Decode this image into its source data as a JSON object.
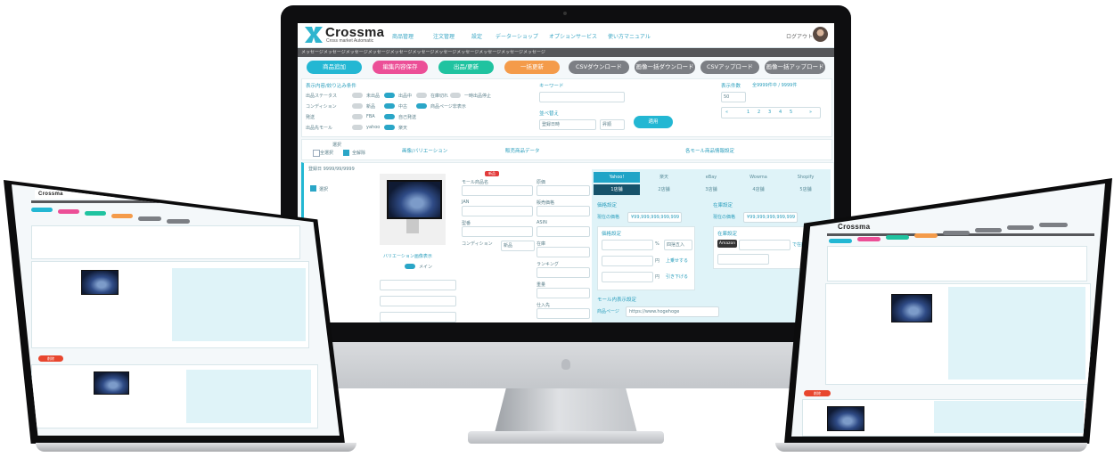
{
  "app": {
    "brand": "Crossma",
    "tagline": "Cross market Automatic",
    "nav": [
      "商品管理",
      "注文管理",
      "設定",
      "データーショップ",
      "オプションサービス",
      "使い方マニュアル"
    ],
    "logout": "ログアウト",
    "ticker": "メッセージメッセージメッセージメッセージメッセージメッセージメッセージメッセージメッセージメッセージメッセージ"
  },
  "actions": [
    {
      "label": "商品追加",
      "color": "#23b7d3"
    },
    {
      "label": "編集内容保存",
      "color": "#ec4f97"
    },
    {
      "label": "出品/更新",
      "color": "#1fc3a0"
    },
    {
      "label": "一括更新",
      "color": "#f49b4a"
    },
    {
      "label": "CSVダウンロード",
      "color": "#7c7f84"
    },
    {
      "label": "画像一括ダウンロード",
      "color": "#7c7f84"
    },
    {
      "label": "CSVアップロード",
      "color": "#7c7f84"
    },
    {
      "label": "画像一括アップロード",
      "color": "#7c7f84"
    }
  ],
  "filters": {
    "title": "表示内容/絞り込み条件",
    "rows": [
      {
        "label": "出品ステータス",
        "opts": [
          "未出品",
          "出品中",
          "在庫切れ",
          "一時出品停止"
        ]
      },
      {
        "label": "コンディション",
        "opts": [
          "新品",
          "中古",
          "商品ページ非表示"
        ]
      },
      {
        "label": "発送",
        "opts": [
          "FBA",
          "自己発送"
        ]
      },
      {
        "label": "出品先モール",
        "opts": [
          "yahoo",
          "楽天"
        ]
      }
    ],
    "keyword_label": "キーワード",
    "sort_label": "並べ替え",
    "sort_value": "登録日時",
    "sort_order": "昇順",
    "apply": "適用",
    "count_label": "表示件数",
    "count_value": "50",
    "count_summary": "全9999件中 / 9999件",
    "pages": [
      "«",
      "1",
      "2",
      "3",
      "4",
      "5",
      "»"
    ]
  },
  "columns": {
    "select": "選択",
    "select_all": "全選択",
    "deselect_all": "全解除",
    "variation": "画像/バリエーション",
    "data": "販売商品データ",
    "mall": "各モール商品情報設定"
  },
  "item": {
    "reg_date": "登録日 9999/99/9999",
    "variation_caption": "バリエーション画像表示",
    "main_label": "メイン",
    "fields_mid": [
      "モール商品名",
      "JAN",
      "型番",
      "コンディション"
    ],
    "condition_value": "新品",
    "fields_right": [
      "原価",
      "販売価格",
      "ASIN",
      "在庫",
      "ランキング",
      "重量",
      "仕入先"
    ],
    "badge": "新品"
  },
  "mall_tabs": [
    "Yahoo!",
    "楽天",
    "eBay",
    "Wowma",
    "Shopify"
  ],
  "stores": [
    "1店舗",
    "2店舗",
    "3店舗",
    "4店舗",
    "5店舗"
  ],
  "price": {
    "title": "価格設定",
    "current_label": "現在の価格",
    "current_value": "¥99,999,999,999,999",
    "title2": "在庫設定",
    "current_value2": "¥99,999,999,999,999",
    "setting": "価格設定",
    "unit": "円",
    "up": "上乗せする",
    "down": "引き下げる",
    "percent": "%",
    "round": "四捨五入",
    "inv_setting": "在庫設定",
    "amazon": "Amazon",
    "inv_link": "で在庫",
    "store_page_label": "モール内表示設定",
    "store_page": "商品ページ",
    "store_url": "https://www.hogehoge"
  },
  "laptop_left": {
    "button": "削除"
  },
  "laptop_right": {
    "button": "削除"
  }
}
